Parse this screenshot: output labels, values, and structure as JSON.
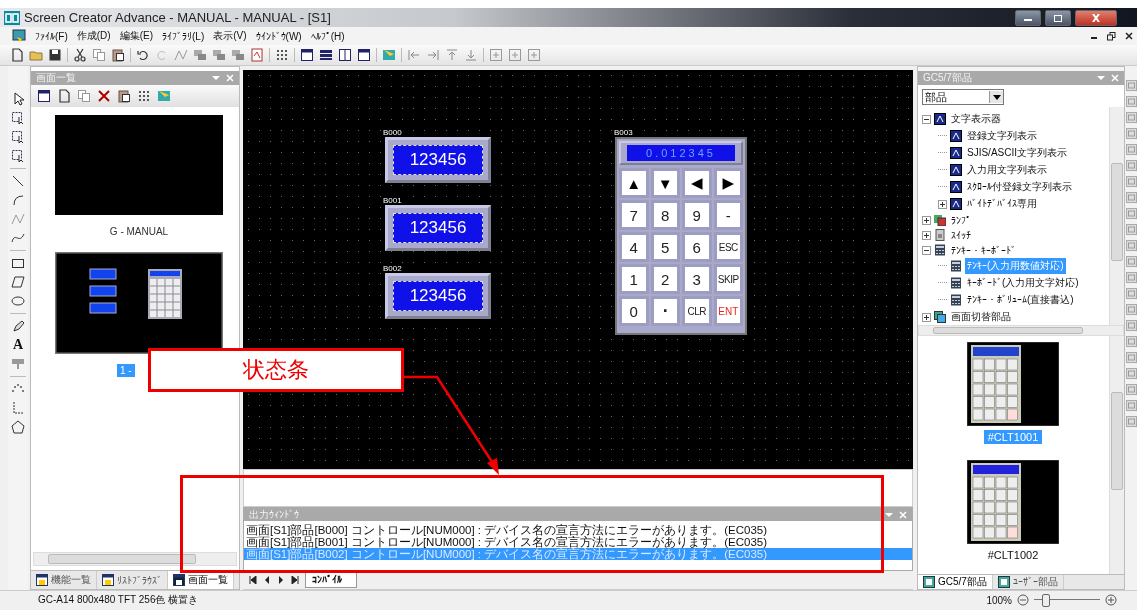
{
  "window": {
    "title": "Screen Creator Advance - MANUAL - MANUAL - [S1]"
  },
  "menu": [
    "ﾌｧｲﾙ(F)",
    "作成(D)",
    "編集(E)",
    "ﾗｲﾌﾞﾗﾘ(L)",
    "表示(V)",
    "ｳｲﾝﾄﾞｳ(W)",
    "ﾍﾙﾌﾟ(H)"
  ],
  "tool_strip": {
    "text_tool": "A"
  },
  "left_panel": {
    "title": "画面一覧",
    "screens": [
      {
        "label": "G - MANUAL",
        "kind": "empty",
        "selected": false
      },
      {
        "label": "1 -",
        "kind": "keypad_screen",
        "selected": true
      }
    ],
    "tabs": [
      {
        "label": "機能一覧",
        "selected": false
      },
      {
        "label": "ﾘｽﾄﾌﾞﾗｳｽﾞ",
        "selected": false
      },
      {
        "label": "画面一覧",
        "selected": true
      }
    ]
  },
  "canvas": {
    "displays": [
      {
        "id": "B000",
        "value": "123456"
      },
      {
        "id": "B001",
        "value": "123456"
      },
      {
        "id": "B002",
        "value": "123456"
      }
    ],
    "keypad": {
      "id": "B003",
      "display": "0.012345",
      "keys": [
        {
          "label": "▲",
          "kind": "arrow"
        },
        {
          "label": "▼",
          "kind": "arrow"
        },
        {
          "label": "◀",
          "kind": "arrow"
        },
        {
          "label": "▶",
          "kind": "arrow"
        },
        {
          "label": "7",
          "kind": "digit"
        },
        {
          "label": "8",
          "kind": "digit"
        },
        {
          "label": "9",
          "kind": "digit"
        },
        {
          "label": "-",
          "kind": "digit"
        },
        {
          "label": "4",
          "kind": "digit"
        },
        {
          "label": "5",
          "kind": "digit"
        },
        {
          "label": "6",
          "kind": "digit"
        },
        {
          "label": "ESC",
          "kind": "command"
        },
        {
          "label": "1",
          "kind": "digit"
        },
        {
          "label": "2",
          "kind": "digit"
        },
        {
          "label": "3",
          "kind": "digit"
        },
        {
          "label": "SKIP",
          "kind": "command"
        },
        {
          "label": "0",
          "kind": "digit"
        },
        {
          "label": ".",
          "kind": "point"
        },
        {
          "label": "CLR",
          "kind": "command"
        },
        {
          "label": "ENT",
          "kind": "enter"
        }
      ]
    }
  },
  "annotation": {
    "label": "状态条"
  },
  "output_window": {
    "title": "出力ｳｨﾝﾄﾞｳ",
    "lines": [
      {
        "text": "画面[S1]部品[B000] コントロール[NUM000] : デバイス名の宣言方法にエラーがあります。(EC035)",
        "selected": false
      },
      {
        "text": "画面[S1]部品[B001] コントロール[NUM000] : デバイス名の宣言方法にエラーがあります。(EC035)",
        "selected": false
      },
      {
        "text": "画面[S1]部品[B002] コントロール[NUM000] : デバイス名の宣言方法にエラーがあります。(EC035)",
        "selected": true
      }
    ],
    "tabs": [
      {
        "label": "ｺﾝﾊﾟｲﾙ",
        "selected": true
      }
    ]
  },
  "right_panel": {
    "title": "GC5/7部品",
    "dropdown": "部品",
    "tree": [
      {
        "label": "文字表示器",
        "kind": "text",
        "expanded": true,
        "selected": false,
        "children": [
          {
            "label": "登録文字列表示",
            "kind": "text",
            "selected": false
          },
          {
            "label": "SJIS/ASCII文字列表示",
            "kind": "text",
            "selected": false
          },
          {
            "label": "入力用文字列表示",
            "kind": "text",
            "selected": false
          },
          {
            "label": "ｽｸﾛｰﾙ付登録文字列表示",
            "kind": "text",
            "selected": false
          },
          {
            "label": "ﾊﾞｲﾄﾃﾞﾊﾞｲｽ専用",
            "kind": "text",
            "expanded": false,
            "selected": false
          }
        ]
      },
      {
        "label": "ﾗﾝﾌﾟ",
        "kind": "lamp",
        "expanded": false,
        "selected": false
      },
      {
        "label": "ｽｲｯﾁ",
        "kind": "switch",
        "expanded": false,
        "selected": false
      },
      {
        "label": "ﾃﾝｷｰ・ｷｰﾎﾞｰﾄﾞ",
        "kind": "keypad",
        "expanded": true,
        "selected": false,
        "children": [
          {
            "label": "ﾃﾝｷｰ(入力用数値対応)",
            "kind": "keypad",
            "selected": true
          },
          {
            "label": "ｷｰﾎﾞｰﾄﾞ(入力用文字対応)",
            "kind": "keypad",
            "selected": false
          },
          {
            "label": "ﾃﾝｷｰ・ﾎﾞﾘｭｰﾑ(直接書込)",
            "kind": "keypad",
            "selected": false
          }
        ]
      },
      {
        "label": "画面切替部品",
        "kind": "screen",
        "expanded": false,
        "selected": false
      }
    ],
    "thumbnails": [
      {
        "label": "#CLT1001",
        "selected": true
      },
      {
        "label": "#CLT1002",
        "selected": false
      }
    ],
    "tabs": [
      {
        "label": "GC5/7部品",
        "selected": true
      },
      {
        "label": "ﾕｰｻﾞｰ部品",
        "selected": false
      }
    ]
  },
  "status_bar": {
    "device": "GC-A14 800x480 TFT 256色 横置き",
    "zoom": "100%",
    "zoom_slider": {
      "level": 0.12
    }
  }
}
